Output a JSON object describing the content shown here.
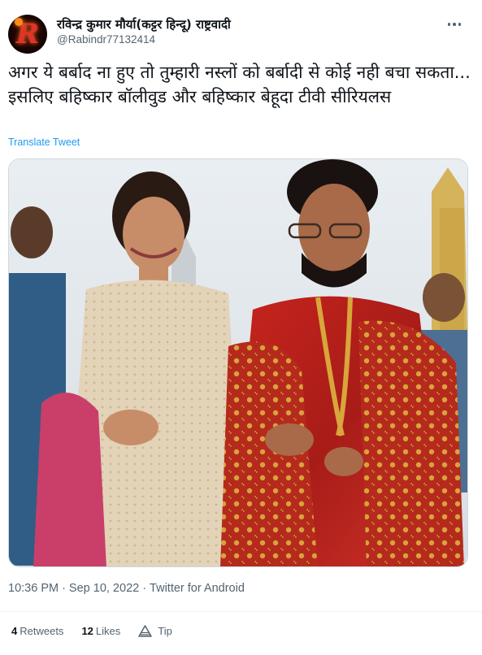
{
  "author": {
    "display_name": "रविन्द्र कुमार मौर्या(कट्टर हिन्दू) राष्ट्रवादी",
    "handle": "@Rabindr77132414",
    "avatar_letter": "R"
  },
  "tweet": {
    "text": "अगर ये बर्बाद ना हुए तो तुम्हारी नस्लों को बर्बादी से कोई नही बचा सकता... इसलिए बहिष्कार बॉलीवुड और बहिष्कार बेहूदा टीवी सीरियलस",
    "translate_label": "Translate Tweet",
    "time": "10:36 PM",
    "date": "Sep 10, 2022",
    "source": "Twitter for Android"
  },
  "stats": {
    "retweets_count": "4",
    "retweets_label": "Retweets",
    "likes_count": "12",
    "likes_label": "Likes",
    "tip_label": "Tip"
  },
  "colors": {
    "link": "#1d9bf0",
    "muted": "#536471",
    "text": "#0f1419"
  }
}
